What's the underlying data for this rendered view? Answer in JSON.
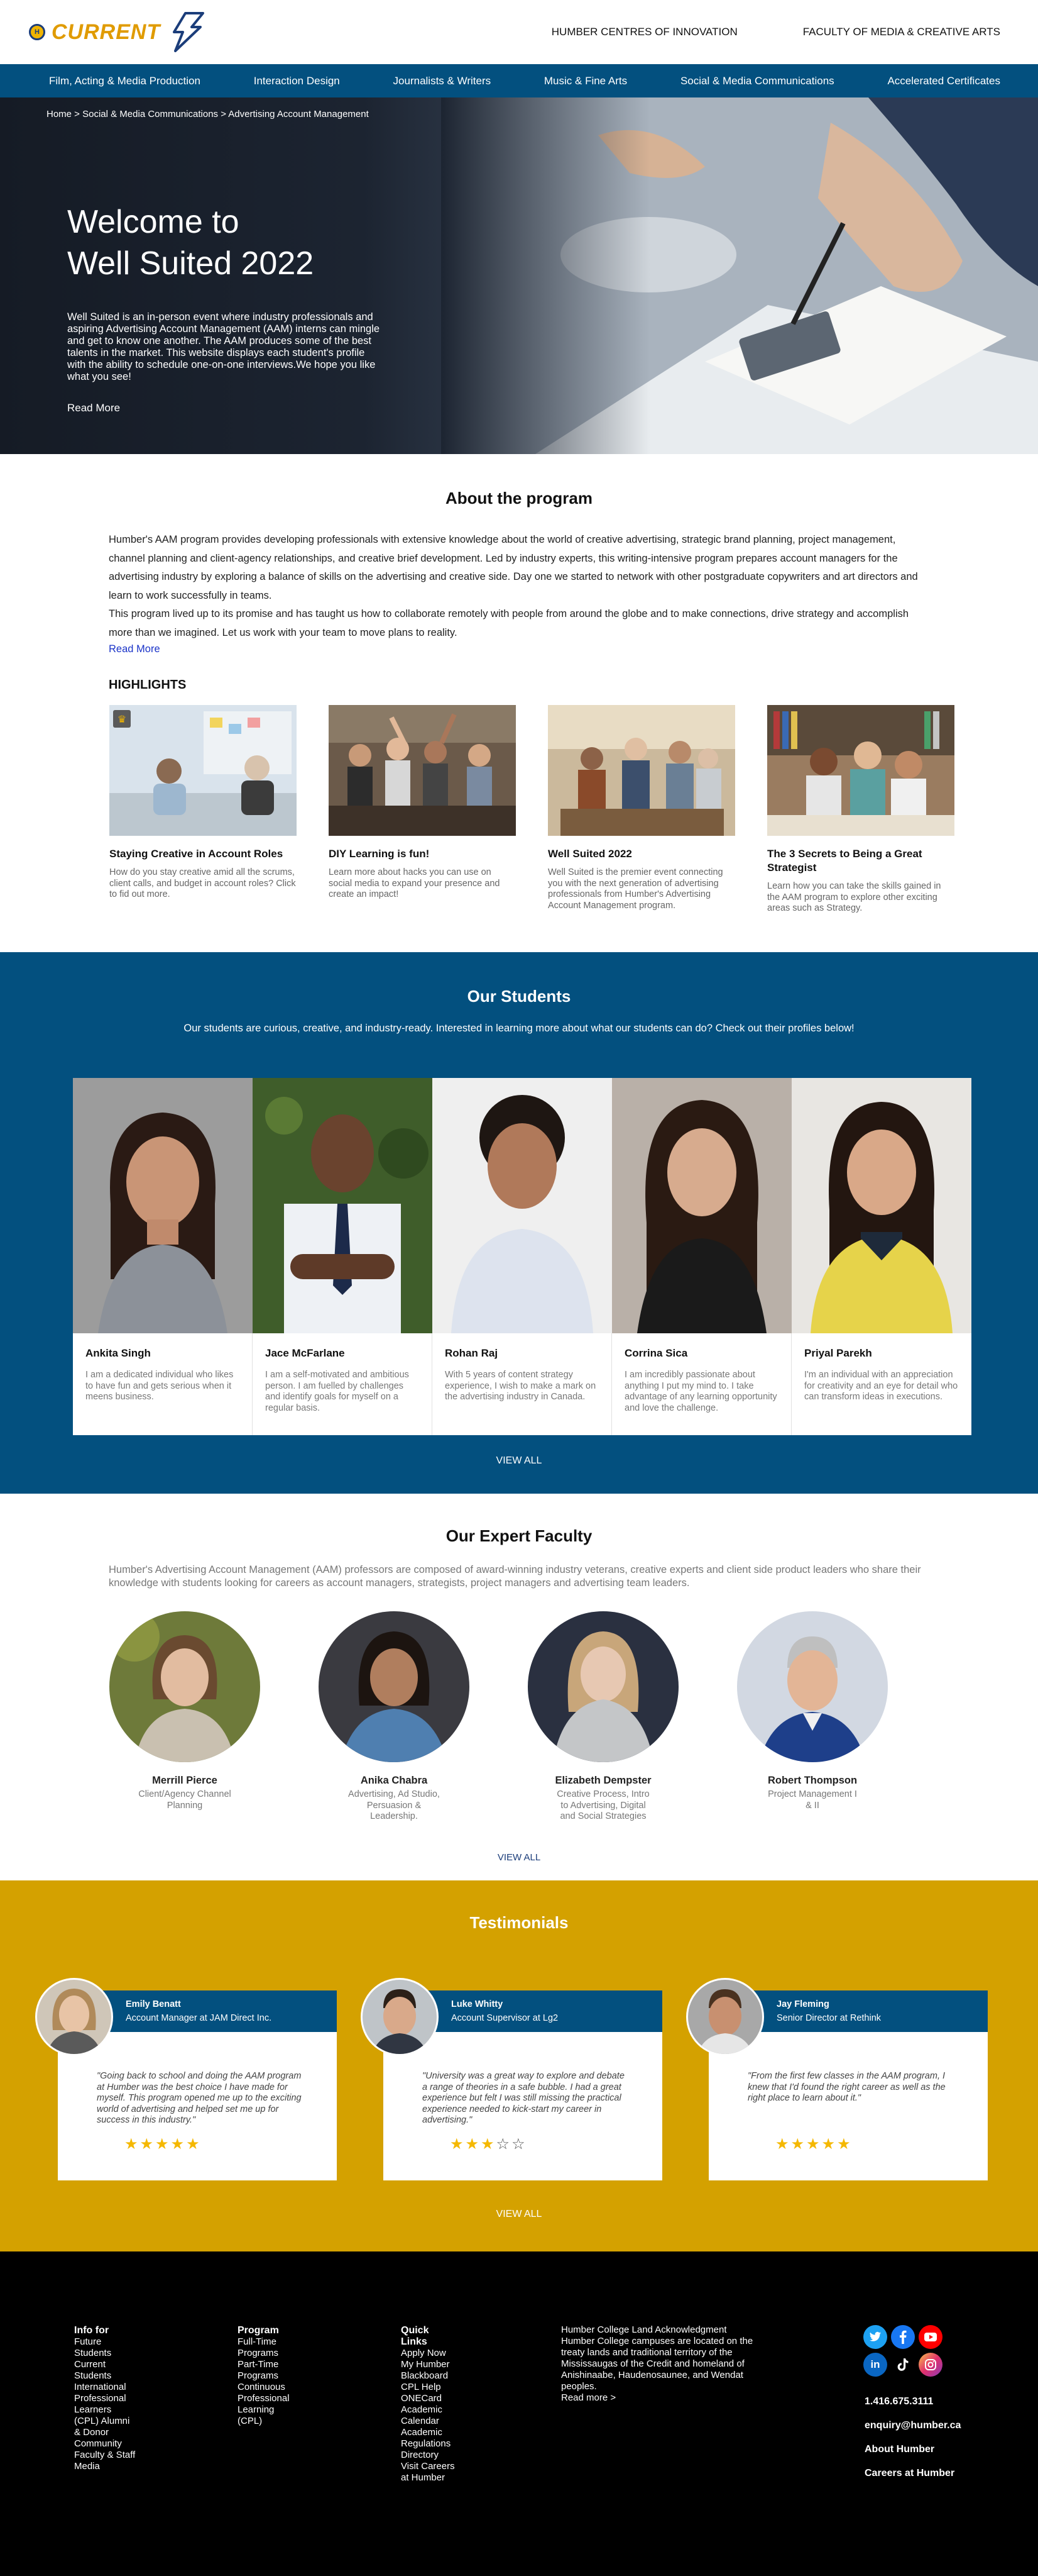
{
  "header": {
    "logo_text": "CURRENT",
    "top_links": [
      "HUMBER CENTRES OF INNOVATION",
      "FACULTY OF MEDIA & CREATIVE ARTS"
    ]
  },
  "nav": {
    "items": [
      "Film, Acting & Media Production",
      "Interaction Design",
      "Journalists & Writers",
      "Music & Fine Arts",
      "Social & Media Communications",
      "Accelerated Certificates"
    ]
  },
  "hero": {
    "breadcrumb": "Home > Social & Media Communications > Advertising Account Management",
    "title_line1": "Welcome to",
    "title_line2": "Well Suited 2022",
    "description": "Well Suited is an in-person event where industry professionals and aspiring Advertising Account Management (AAM) interns can mingle and get to know one another. The AAM produces some of the best talents in the market. This website displays each student's profile with the ability to schedule one-on-one interviews.We hope you like what you see!",
    "read_more": "Read More"
  },
  "about": {
    "title": "About the program",
    "paragraph1": "Humber's AAM program provides developing professionals with extensive knowledge about the world of creative advertising, strategic brand planning, project management, channel planning and client-agency relationships, and creative brief development. Led by industry experts, this writing-intensive program prepares account managers for the advertising industry by exploring a balance of skills on the advertising and creative side. Day one we started to network with other postgraduate copywriters and art directors and learn to work successfully in teams.",
    "paragraph2": "This program lived up to its promise and has taught us how to collaborate remotely with people from around the globe and to make connections, drive strategy and accomplish more than we imagined. Let us work with your team to move plans to reality.",
    "read_more": "Read More",
    "highlights_label": "HIGHLIGHTS",
    "highlights": [
      {
        "title": "Staying Creative in Account Roles",
        "desc": "How do you stay creative amid all the scrums, client calls, and budget in account roles? Click to fid out more."
      },
      {
        "title": "DIY Learning is fun!",
        "desc": "Learn more about hacks you can use on social media to expand your presence and create an impact!"
      },
      {
        "title": "Well Suited 2022",
        "desc": "Well Suited is the premier event connecting you with the next generation of advertising professionals from Humber's Advertising Account Management program."
      },
      {
        "title": "The 3 Secrets to Being a Great Strategist",
        "desc": "Learn how you can take the skills gained in the AAM program to explore other exciting areas such as Strategy."
      }
    ]
  },
  "students": {
    "title": "Our Students",
    "subtitle": "Our students are curious, creative, and industry-ready. Interested in learning more about what our students can do? Check out their profiles below!",
    "list": [
      {
        "name": "Ankita Singh",
        "desc": "I am a dedicated individual who likes to have fun and gets serious when it meens business."
      },
      {
        "name": "Jace McFarlane",
        "desc": "I am a self-motivated and ambitious person. I am fuelled by challenges and identify goals for myself on a regular basis."
      },
      {
        "name": "Rohan Raj",
        "desc": "With 5 years of content strategy experience, I wish to make a mark on the advertising industry in Canada."
      },
      {
        "name": "Corrina Sica",
        "desc": "I am incredibly passionate about anything I put my mind to. I take advantage of any learning opportunity and love the challenge."
      },
      {
        "name": "Priyal Parekh",
        "desc": "I'm an individual with an appreciation for creativity and an eye for detail who can transform ideas in executions."
      }
    ],
    "view_all": "VIEW ALL"
  },
  "faculty": {
    "title": "Our Expert Faculty",
    "subtitle": "Humber's Advertising Account Management (AAM) professors are composed of award-winning industry veterans, creative experts and client side product leaders who share their knowledge with students looking for careers as account managers, strategists, project managers and advertising team leaders.",
    "list": [
      {
        "name": "Merrill Pierce",
        "role": "Client/Agency Channel Planning"
      },
      {
        "name": "Anika Chabra",
        "role": "Advertising, Ad Studio, Persuasion & Leadership."
      },
      {
        "name": "Elizabeth Dempster",
        "role": "Creative Process, Intro to Advertising, Digital and Social Strategies"
      },
      {
        "name": "Robert Thompson",
        "role": "Project Management I & II"
      }
    ],
    "view_all": "VIEW ALL"
  },
  "testimonials": {
    "title": "Testimonials",
    "list": [
      {
        "name": "Emily Benatt",
        "position": "Account Manager at JAM Direct Inc.",
        "quote": "\"Going back to school and doing the AAM program at Humber was the best choice I have made for myself. This program opened me up to the exciting world of advertising and helped set me up for success in this industry.\"",
        "stars": "★★★★★",
        "rating": 5
      },
      {
        "name": "Luke Whitty",
        "position": "Account Supervisor at Lg2",
        "quote": "\"University was a great way to explore and debate a range of theories in a safe bubble. I had a great experience but felt I was still missing the practical experience needed to kick-start my career in advertising.\"",
        "stars": "★★★☆☆",
        "rating": 3
      },
      {
        "name": "Jay Fleming",
        "position": "Senior Director at Rethink",
        "quote": "\"From the first few classes in the AAM program, I knew that I'd found the right career as well as the right place to learn about it.\"",
        "stars": "★★★★★",
        "rating": 5
      }
    ],
    "view_all": "VIEW ALL"
  },
  "footer": {
    "info_head": "Info for",
    "info_items": "Future Students Current Students International Professional Learners (CPL) Alumni & Donor Community Faculty & Staff Media",
    "program_head": "Program",
    "program_items": "Full-Time Programs Part-Time Programs Continuous Professional Learning (CPL)",
    "quick_head": "Quick Links",
    "quick_items": "Apply Now My Humber Blackboard CPL Help ONECard Academic Calendar Academic Regulations Directory Visit Careers at Humber",
    "land_ack": "Humber College Land Acknowledgment Humber College campuses are located on the treaty lands and traditional territory of the Mississaugas of the Credit and homeland of Anishinaabe, Haudenosaunee, and Wendat peoples.",
    "land_more": "Read more >",
    "phone": "1.416.675.3111",
    "email": "enquiry@humber.ca",
    "about": "About Humber",
    "careers": "Careers at Humber",
    "social_icons": [
      "twitter-icon",
      "facebook-icon",
      "youtube-icon",
      "linkedin-icon",
      "tiktok-icon",
      "instagram-icon"
    ]
  }
}
